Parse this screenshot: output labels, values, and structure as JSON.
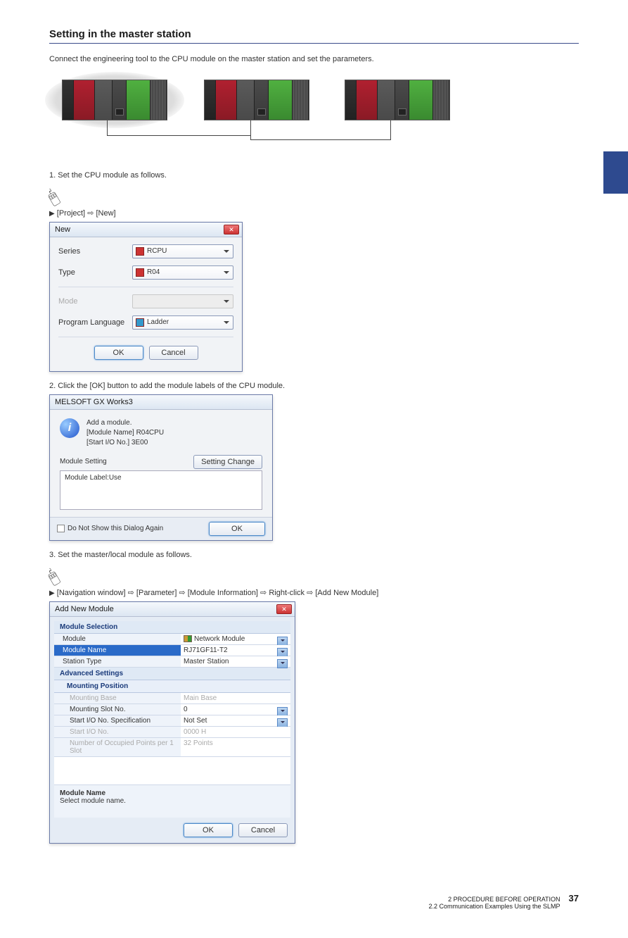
{
  "section_heading": "Setting in the master station",
  "intro_text": "Connect the engineering tool to the CPU module on the master station and set the parameters.",
  "step1": "1. Set the CPU module as follows.",
  "nav1_prefix": "[Project]",
  "nav1_arrow": "⇨",
  "nav1_item": "[New]",
  "dlg_new": {
    "title": "New",
    "series_label": "Series",
    "series_value": "RCPU",
    "type_label": "Type",
    "type_value": "R04",
    "mode_label": "Mode",
    "mode_value": "",
    "lang_label": "Program Language",
    "lang_value": "Ladder",
    "ok": "OK",
    "cancel": "Cancel"
  },
  "step2": "2. Click the [OK] button to add the module labels of the CPU module.",
  "dlg_msg": {
    "title": "MELSOFT GX Works3",
    "line1": "Add a module.",
    "line2": "[Module Name] R04CPU",
    "line3": "[Start I/O No.] 3E00",
    "ms_label": "Module Setting",
    "setting_change": "Setting Change",
    "module_label_use": "Module Label:Use",
    "chk_label": "Do Not Show this Dialog Again",
    "ok": "OK"
  },
  "step3": "3. Set the master/local module as follows.",
  "nav2": "[Navigation window] ⇨ [Parameter] ⇨ [Module Information] ⇨ Right-click ⇨ [Add New Module]",
  "dlg_add": {
    "title": "Add New Module",
    "sec_modsel": "Module Selection",
    "row_module_k": "Module",
    "row_module_v": "Network Module",
    "row_modname_k": "Module Name",
    "row_modname_v": "RJ71GF11-T2",
    "row_station_k": "Station Type",
    "row_station_v": "Master Station",
    "sec_adv": "Advanced Settings",
    "sec_mount": "Mounting Position",
    "row_base_k": "Mounting Base",
    "row_base_v": "Main Base",
    "row_slot_k": "Mounting Slot No.",
    "row_slot_v": "0",
    "row_iospec_k": "Start I/O No. Specification",
    "row_iospec_v": "Not Set",
    "row_io_k": "Start I/O No.",
    "row_io_v": "0000 H",
    "row_pts_k": "Number of Occupied Points per 1 Slot",
    "row_pts_v": "32 Points",
    "desc_title": "Module Name",
    "desc_text": "Select module name.",
    "ok": "OK",
    "cancel": "Cancel"
  },
  "footer": {
    "sec_line1": "2  PROCEDURE BEFORE OPERATION",
    "sec_line2": "2.2  Communication Examples Using the SLMP",
    "page": "37"
  }
}
